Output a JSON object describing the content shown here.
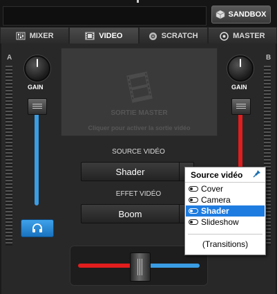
{
  "header": {
    "sandbox_label": "SANDBOX"
  },
  "tabs": [
    {
      "label": "MIXER",
      "icon": "mixer-icon"
    },
    {
      "label": "VIDEO",
      "icon": "film-icon"
    },
    {
      "label": "SCRATCH",
      "icon": "vinyl-icon"
    },
    {
      "label": "MASTER",
      "icon": "target-icon"
    }
  ],
  "deck_left": {
    "label": "A",
    "gain_label": "GAIN",
    "color": "#3a9de4"
  },
  "deck_right": {
    "label": "B",
    "gain_label": "GAIN",
    "color": "#e11d1d"
  },
  "preview": {
    "title": "SORTIE MASTER",
    "subtitle": "Cliquer pour activer la sortie vidéo"
  },
  "source": {
    "label": "SOURCE VIDÉO",
    "value": "Shader"
  },
  "effect": {
    "label": "EFFET VIDÉO",
    "value": "Boom"
  },
  "menu": {
    "title": "Source vidéo",
    "items": [
      {
        "label": "Cover",
        "selected": false
      },
      {
        "label": "Camera",
        "selected": false
      },
      {
        "label": "Shader",
        "selected": true
      },
      {
        "label": "Slideshow",
        "selected": false
      }
    ],
    "transitions_label": "(Transitions)"
  },
  "colors": {
    "accent": "#1e7ce0",
    "deck_a": "#3a9de4",
    "deck_b": "#e11d1d"
  }
}
